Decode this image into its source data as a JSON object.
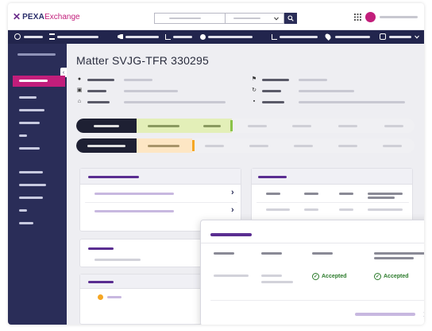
{
  "brand": {
    "x_mark": "✕",
    "bold": "PEXA",
    "rest": "Exchange"
  },
  "matter": {
    "title": "Matter SVJG-TFR 330295"
  },
  "popup": {
    "status_1": "Accepted",
    "status_2": "Accepted"
  },
  "colors": {
    "navy": "#22254d",
    "sidebar": "#2a2d58",
    "magenta": "#c21e7b",
    "purple_accent": "#5a2d91",
    "green": "#8bc34a",
    "orange": "#f5a623"
  },
  "icons": {
    "search": "search-icon",
    "apps": "grid-icon",
    "chevron": "chevron-right-icon",
    "check": "check-circle-icon"
  }
}
